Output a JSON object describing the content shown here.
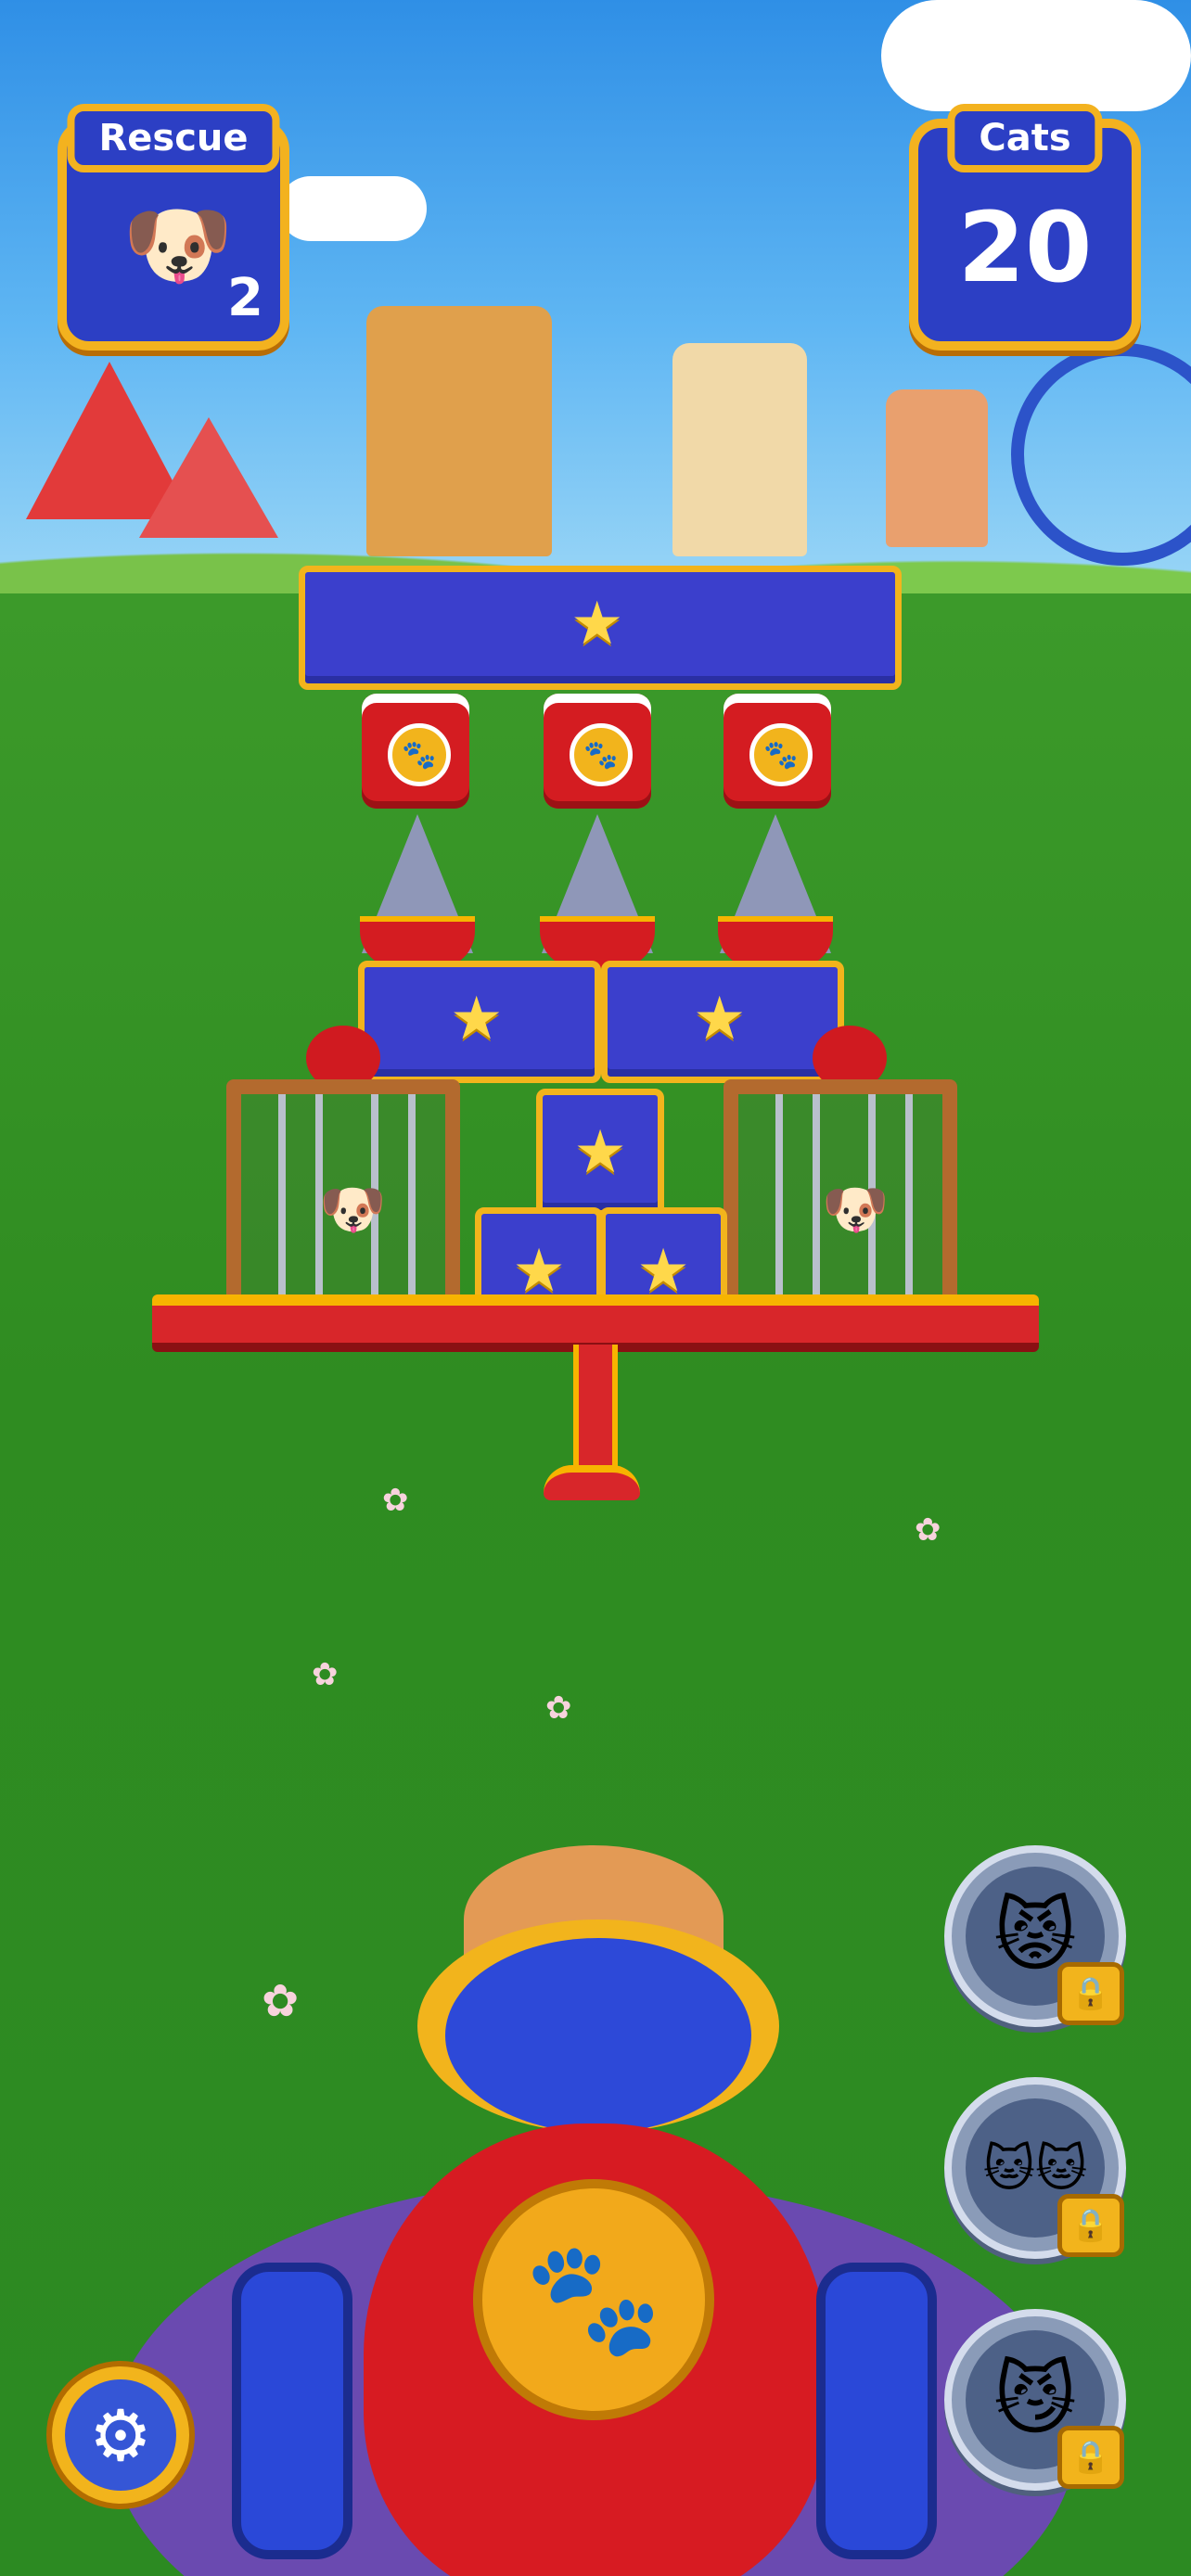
{
  "hud": {
    "rescue": {
      "label": "Rescue",
      "count": "2",
      "icon": "puppy-icon"
    },
    "cats": {
      "label": "Cats",
      "value": "20"
    }
  },
  "tower": {
    "star_blocks": 6,
    "caged_puppies": 2
  },
  "abilities": [
    {
      "name": "red-cat",
      "locked": true
    },
    {
      "name": "triple-blue-cats",
      "locked": true
    },
    {
      "name": "grumpy-cat",
      "locked": true
    }
  ],
  "colors": {
    "accent_gold": "#f2b41c",
    "block_blue": "#3b3fcc",
    "cannon_red": "#d71b22",
    "grass": "#2f8c21",
    "sky": "#4aa6ef"
  },
  "icons": {
    "settings": "gear-icon",
    "lock": "padlock-icon",
    "paw": "paw-icon",
    "star": "star-icon"
  }
}
